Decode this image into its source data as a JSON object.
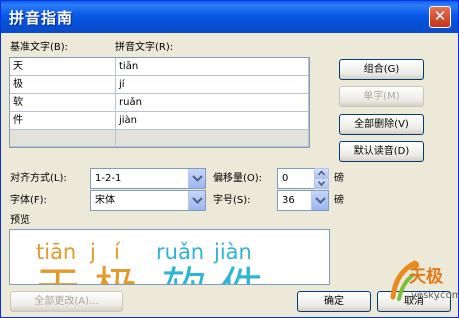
{
  "window": {
    "title": "拼音指南",
    "close_glyph": "✕"
  },
  "headers": {
    "base_text": "基准文字(B):",
    "ruby_text": "拼音文字(R):"
  },
  "rows": [
    {
      "base": "天",
      "ruby": "tiān"
    },
    {
      "base": "极",
      "ruby": "jí"
    },
    {
      "base": "软",
      "ruby": "ruǎn"
    },
    {
      "base": "件",
      "ruby": "jiàn"
    }
  ],
  "buttons": {
    "group": "组合(G)",
    "mono": "单字(M)",
    "clear_all": "全部删除(V)",
    "default_reading": "默认读音(D)",
    "apply_all": "全部更改(A)...",
    "ok": "确定",
    "cancel": "取消"
  },
  "options": {
    "alignment_label": "对齐方式(L):",
    "alignment_value": "1-2-1",
    "offset_label": "偏移量(O):",
    "offset_value": "0",
    "offset_unit": "磅",
    "font_label": "字体(F):",
    "font_value": "宋体",
    "size_label": "字号(S):",
    "size_value": "36",
    "size_unit": "磅"
  },
  "preview": {
    "label": "预览",
    "pinyin": [
      "tiān",
      "j",
      "í",
      "ruǎn",
      "jiàn"
    ],
    "hanzi": [
      "天",
      "极",
      "软",
      "件"
    ]
  },
  "watermark": {
    "text_cn": "天极",
    "text_en": "yesky",
    "text_domain": ".com"
  },
  "colors": {
    "pinyin_a": "#E29A2A",
    "pinyin_b": "#2FB3D6",
    "titlebar": "#0A58E6"
  }
}
